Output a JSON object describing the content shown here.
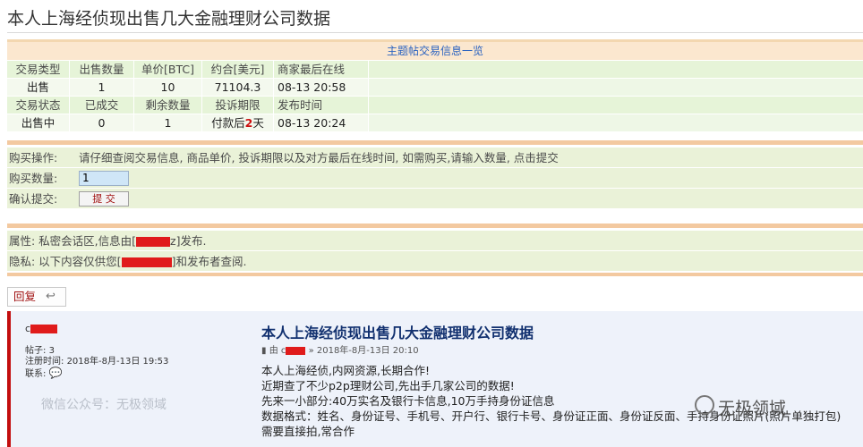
{
  "page_title": "本人上海经侦现出售几大金融理财公司数据",
  "trade": {
    "header": "主题帖交易信息一览",
    "row1_labels": [
      "交易类型",
      "出售数量",
      "单价[BTC]",
      "约合[美元]",
      "商家最后在线"
    ],
    "row1_values": [
      "出售",
      "1",
      "10",
      "71104.3",
      "08-13 20:58"
    ],
    "row2_labels": [
      "交易状态",
      "已成交",
      "剩余数量",
      "投诉期限",
      "发布时间"
    ],
    "row2_values": [
      "出售中",
      "0",
      "1",
      "付款后",
      "2",
      "天",
      "08-13 20:24"
    ]
  },
  "buy": {
    "op_label": "购买操作:",
    "op_text": "请仔细查阅交易信息, 商品单价, 投诉期限以及对方最后在线时间, 如需购买,请输入数量, 点击提交",
    "qty_label": "购买数量:",
    "qty_value": "1",
    "confirm_label": "确认提交:",
    "submit_label": "提 交"
  },
  "info": {
    "attr_prefix": "属性: 私密会话区,信息由[",
    "attr_visible": "z",
    "attr_suffix": "]发布.",
    "privacy_prefix": "隐私: 以下内容仅供您[",
    "privacy_suffix": "]和发布者查阅."
  },
  "reply_label": "回复",
  "post": {
    "author_initial": "c",
    "posts_label": "帖子:",
    "posts_count": "3",
    "registered_label": "注册时间:",
    "registered_value": "2018年-8月-13日 19:53",
    "contact_label": "联系:",
    "title": "本人上海经侦现出售几大金融理财公司数据",
    "byline_prefix": "由 c",
    "byline_suffix": "» 2018年-8月-13日 20:10",
    "lines": [
      "本人上海经侦,内网资源,长期合作!",
      "近期查了不少p2p理财公司,先出手几家公司的数据!",
      "先来一小部分:40万实名及银行卡信息,10万手持身份证信息",
      "数据格式：姓名、身份证号、手机号、开户行、银行卡号、身份证正面、身份证反面、手持身份证照片(照片单独打包)",
      "需要直接拍,常合作"
    ]
  },
  "watermark_left": "微信公众号：无极领域",
  "watermark_right": "无极领域",
  "colors": {
    "accent_red": "#cc1010",
    "link_blue": "#2a62c0",
    "row_green": "#e6f4d8",
    "border_orange": "#f3c9a0"
  }
}
